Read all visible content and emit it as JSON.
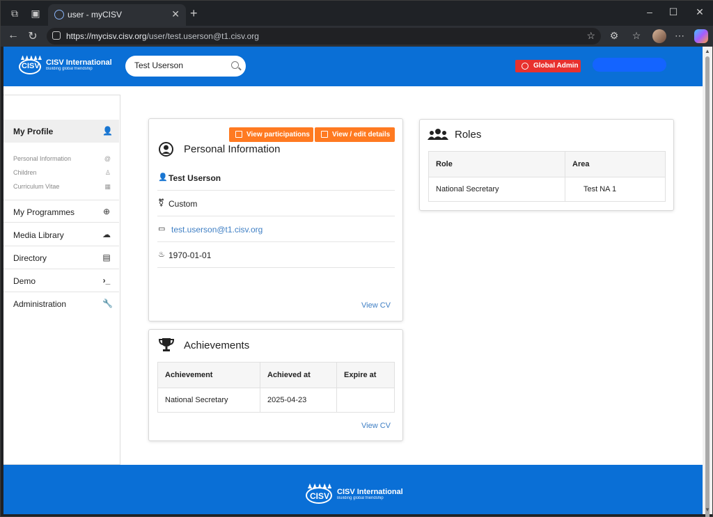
{
  "browser": {
    "tab_title": "user - myCISV",
    "url_host": "https://mycisv.cisv.org",
    "url_path": "/user/test.userson@t1.cisv.org"
  },
  "header": {
    "org_name": "CISV International",
    "org_tagline": "Building global friendship",
    "search_value": "Test Userson",
    "admin_badge": "Global Admin",
    "brand_color": "#0a6fd6",
    "badge_color": "#e8312e"
  },
  "sidebar": {
    "my_profile": "My Profile",
    "sub_items": [
      "Personal Information",
      "Children",
      "Curriculum Vitae"
    ],
    "items": [
      "My Programmes",
      "Media Library",
      "Directory",
      "Demo",
      "Administration"
    ]
  },
  "personal": {
    "btn_participations": "View participations",
    "btn_edit": "View / edit details",
    "title": "Personal Information",
    "name": "Test Userson",
    "gender": "Custom",
    "email": "test.userson@t1.cisv.org",
    "birthdate": "1970-01-01",
    "view_cv": "View CV"
  },
  "roles": {
    "title": "Roles",
    "headers": [
      "Role",
      "Area"
    ],
    "rows": [
      [
        "National Secretary",
        "Test NA 1"
      ]
    ]
  },
  "achievements": {
    "title": "Achievements",
    "headers": [
      "Achievement",
      "Achieved at",
      "Expire at"
    ],
    "rows": [
      [
        "National Secretary",
        "2025-04-23",
        ""
      ]
    ],
    "view_cv": "View CV"
  },
  "footer": {
    "org_name": "CISV International",
    "org_tagline": "Building global friendship"
  }
}
